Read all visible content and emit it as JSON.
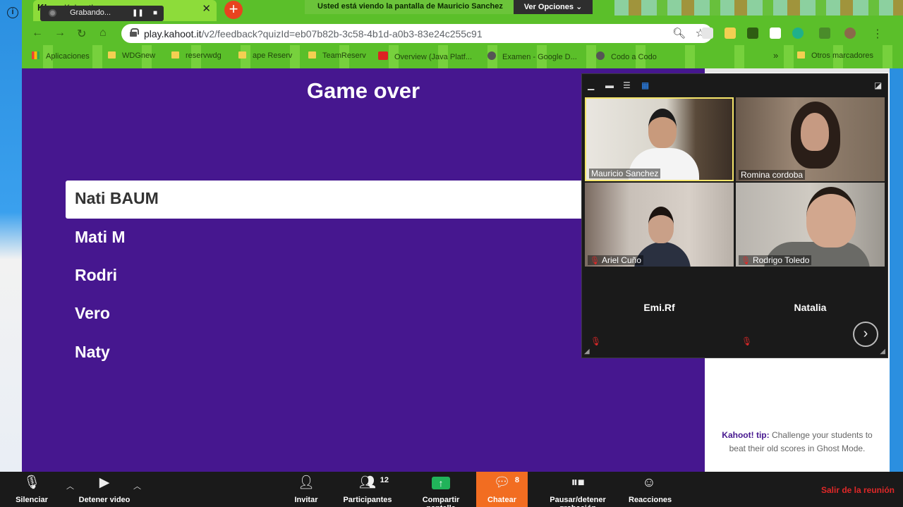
{
  "browser": {
    "tab_title": "Kahoot!",
    "tab_logo": "K!",
    "url_host": "play.kahoot.it",
    "url_path": "/v2/feedback?quizId=eb07b82b-3c58-4b1d-a0b3-83e24c255c91",
    "bookmarks": [
      "Aplicaciones",
      "WDGnew",
      "reservwdg",
      "ape Reserv",
      "TeamReserv",
      "Overview (Java Platf...",
      "Examen - Google D...",
      "Codo a Codo",
      "Otros marcadores"
    ],
    "bookmarks_more": "»"
  },
  "recording": {
    "label": "Grabando..."
  },
  "share_banner": {
    "message": "Usted está viendo la pantalla de  Mauricio Sanchez",
    "options": "Ver Opciones ⌄"
  },
  "kahoot": {
    "title": "Game over",
    "players": [
      "Nati BAUM",
      "Mati M",
      "Rodri",
      "Vero",
      "Naty"
    ],
    "tip_label": "Kahoot! tip:",
    "tip_text": " Challenge your students to beat their old scores in Ghost Mode."
  },
  "gallery": {
    "participants": [
      {
        "name": "Mauricio Sanchez",
        "muted": false,
        "video": true,
        "active": true
      },
      {
        "name": "Romina cordoba",
        "muted": false,
        "video": true,
        "active": false
      },
      {
        "name": "Ariel Cuño",
        "muted": true,
        "video": true,
        "active": false
      },
      {
        "name": "Rodrigo Toledo",
        "muted": true,
        "video": true,
        "active": false
      },
      {
        "name": "Emi.Rf",
        "muted": true,
        "video": false,
        "active": false
      },
      {
        "name": "Natalia",
        "muted": true,
        "video": false,
        "active": false
      }
    ]
  },
  "zoom_bar": {
    "mute": "Silenciar",
    "stop_video": "Detener video",
    "invite": "Invitar",
    "participants": "Participantes",
    "participants_count": "12",
    "share": "Compartir pantalla",
    "chat": "Chatear",
    "chat_count": "8",
    "pause_record": "Pausar/detener grabación",
    "reactions": "Reacciones",
    "leave": "Salir de la reunión"
  },
  "colors": {
    "kahoot_purple": "#46178f",
    "chrome_green": "#5bbf2a",
    "chat_orange": "#f26d21",
    "leave_red": "#e02828"
  }
}
